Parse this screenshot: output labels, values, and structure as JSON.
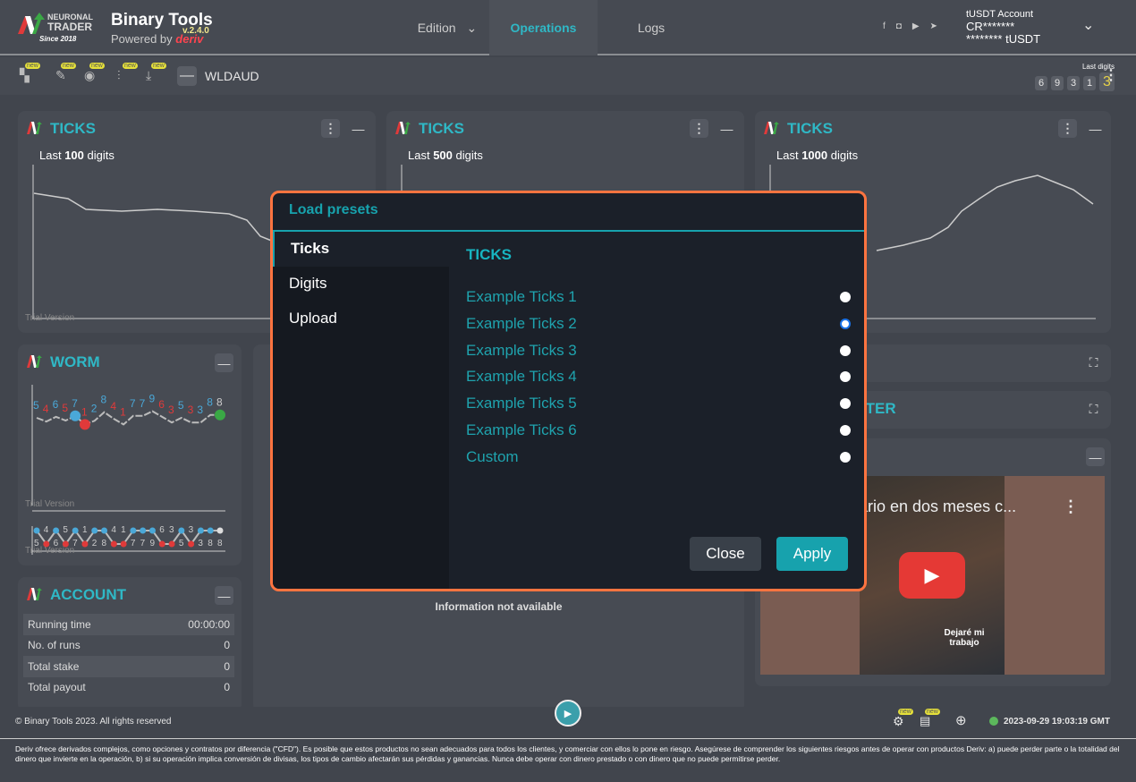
{
  "header": {
    "logo_text": "NEURONAL TRADER Since 2018",
    "title": "Binary Tools",
    "version": "v.2.4.0",
    "powered_by": "Powered by",
    "powered_brand": "deriv",
    "nav": [
      {
        "label": "Edition"
      },
      {
        "label": "Operations",
        "active": true
      },
      {
        "label": "Logs"
      }
    ],
    "social_icons": [
      "facebook-icon",
      "instagram-icon",
      "youtube-icon",
      "telegram-icon"
    ],
    "account": {
      "label": "tUSDT Account",
      "id": "CR*******",
      "balance": "******** tUSDT"
    }
  },
  "toolbar": {
    "new_badge": "new",
    "symbol": "WLDAUD",
    "last_digits_label": "Last digits",
    "last_digits": [
      "6",
      "9",
      "3",
      "1",
      "3"
    ]
  },
  "panels": {
    "ticks": [
      {
        "title": "TICKS",
        "prefix": "Last",
        "count": "100",
        "suffix": "digits"
      },
      {
        "title": "TICKS",
        "prefix": "Last",
        "count": "500",
        "suffix": "digits"
      },
      {
        "title": "TICKS",
        "prefix": "Last",
        "count": "1000",
        "suffix": "digits"
      }
    ],
    "trial": "Trial Version",
    "worm": {
      "title": "WORM",
      "digits": [
        "5",
        "4",
        "6",
        "5",
        "7",
        "1",
        "2",
        "8",
        "4",
        "1",
        "7",
        "7",
        "9",
        "6",
        "3",
        "5",
        "3",
        "3",
        "8",
        "8"
      ]
    },
    "account": {
      "title": "ACCOUNT",
      "rows": [
        {
          "label": "Running time",
          "value": "00:00:00"
        },
        {
          "label": "No. of runs",
          "value": "0"
        },
        {
          "label": "Total stake",
          "value": "0"
        },
        {
          "label": "Total payout",
          "value": "0"
        }
      ]
    },
    "middle": {
      "info": "Information not available"
    },
    "right": {
      "title_partial": "ENTER",
      "video_title": "ario en dos meses c...",
      "video_caption": "Dejaré mi trabajo"
    }
  },
  "modal": {
    "title": "Load presets",
    "tabs": [
      "Ticks",
      "Digits",
      "Upload"
    ],
    "section": "TICKS",
    "options": [
      {
        "label": "Example Ticks 1",
        "selected": false
      },
      {
        "label": "Example Ticks 2",
        "selected": true
      },
      {
        "label": "Example Ticks 3",
        "selected": false
      },
      {
        "label": "Example Ticks 4",
        "selected": false
      },
      {
        "label": "Example Ticks 5",
        "selected": false
      },
      {
        "label": "Example Ticks 6",
        "selected": false
      },
      {
        "label": "Custom",
        "selected": false
      }
    ],
    "close": "Close",
    "apply": "Apply"
  },
  "footer": {
    "copyright": "© Binary Tools 2023. All rights reserved",
    "datetime": "2023-09-29 19:03:19 GMT",
    "status_color": "#5cb85c",
    "disclaimer": "Deriv ofrece derivados complejos, como opciones y contratos por diferencia (\"CFD\"). Es posible que estos productos no sean adecuados para todos los clientes, y comerciar con ellos lo pone en riesgo. Asegúrese de comprender los siguientes riesgos antes de operar con productos Deriv: a) puede perder parte o la totalidad del dinero que invierte en la operación, b) si su operación implica conversión de divisas, los tipos de cambio afectarán sus pérdidas y ganancias. Nunca debe operar con dinero prestado o con dinero que no puede permitirse perder."
  },
  "colors": {
    "accent": "#2fb8c6",
    "modal_border": "#ff7440",
    "apply": "#17a2ad"
  }
}
